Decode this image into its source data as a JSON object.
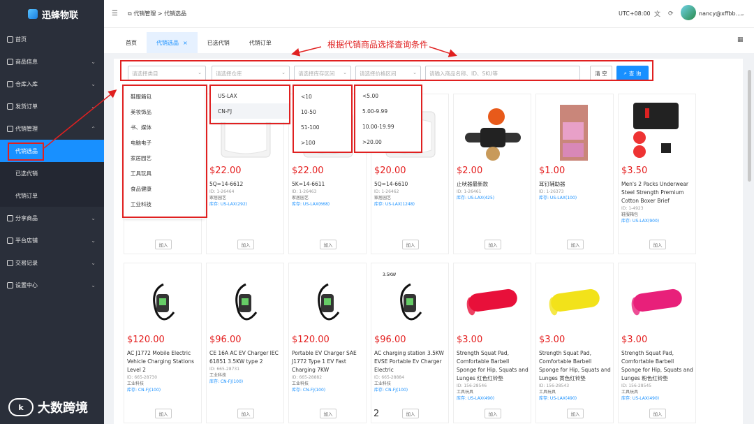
{
  "app": {
    "name": "迅蜂物联"
  },
  "sidebar": {
    "items": [
      {
        "label": "首页"
      },
      {
        "label": "商品信息"
      },
      {
        "label": "仓库入库"
      },
      {
        "label": "发货订单"
      },
      {
        "label": "代销管理"
      },
      {
        "label": "代销选品"
      },
      {
        "label": "已选代销"
      },
      {
        "label": "代销订单"
      },
      {
        "label": "分享商品"
      },
      {
        "label": "平台店铺"
      },
      {
        "label": "交易记录"
      },
      {
        "label": "设置中心"
      }
    ]
  },
  "topbar": {
    "breadcrumb_parent": "代销管理",
    "breadcrumb_sep": ">",
    "breadcrumb_current": "代销选品",
    "timezone": "UTC+08:00",
    "user": "nancy@xffbb...."
  },
  "tabs": [
    {
      "label": "首页"
    },
    {
      "label": "代销选品"
    },
    {
      "label": "已选代销"
    },
    {
      "label": "代销订单"
    }
  ],
  "annotation": "根据代销商品选择查询条件",
  "filters": {
    "category_placeholder": "请选择类目",
    "warehouse_placeholder": "请选择仓库",
    "stock_placeholder": "请选择库存区间",
    "price_placeholder": "请选择价格区间",
    "search_placeholder": "请输入商品名称、ID、SKU等",
    "clear_label": "清 空",
    "query_label": "查 询"
  },
  "dropdowns": {
    "categories": [
      "鞋服箱包",
      "美妆饰品",
      "书、媒体",
      "电脑电子",
      "家居园艺",
      "工具玩具",
      "食品健康",
      "工业科技"
    ],
    "warehouses": [
      "US-LAX",
      "CN-FJ"
    ],
    "stock_ranges": [
      "<10",
      "10-50",
      "51-100",
      ">100"
    ],
    "price_ranges": [
      "<5.00",
      "5.00-9.99",
      "10.00-19.99",
      ">20.00"
    ]
  },
  "add_label": "加入",
  "products_row1": [
    {
      "price": "",
      "title": "",
      "id": "",
      "cat": "",
      "stock": ""
    },
    {
      "price": "$22.00",
      "title": "5Q=14-6612",
      "id": "ID: 1-26464",
      "cat": "家居园艺",
      "stock": "库存: US-LAX(292)"
    },
    {
      "price": "$22.00",
      "title": "5K=14-6611",
      "id": "ID: 1-26463",
      "cat": "家居园艺",
      "stock": "库存: US-LAX(668)"
    },
    {
      "price": "$20.00",
      "title": "5Q=14-6610",
      "id": "ID: 1-26462",
      "cat": "家居园艺",
      "stock": "库存: US-LAX(1248)"
    },
    {
      "price": "$2.00",
      "title": "止吠器最新款",
      "id": "ID: 1-26461",
      "cat": "",
      "stock": "库存: US-LAX(425)"
    },
    {
      "price": "$1.00",
      "title": "耳钉辅助器",
      "id": "ID: 1-26373",
      "cat": "",
      "stock": "库存: US-LAX(100)"
    },
    {
      "price": "$3.50",
      "title": "Men's 2 Packs Underwear Steel Strength Premium Cotton Boxer Brief",
      "id": "ID: 1-4923",
      "cat": "鞋服箱包",
      "stock": "库存: US-LAX(900)"
    }
  ],
  "products_row2": [
    {
      "price": "$120.00",
      "title": "AC J1772 Mobile Electric Vehicle Charging Stations Level 2",
      "id": "ID: 665-28730",
      "cat": "工业科技",
      "stock": "库存: CN-FJ(100)"
    },
    {
      "price": "$96.00",
      "title": "CE 16A AC EV Charger IEC 61851 3.5KW type 2",
      "id": "ID: 665-28731",
      "cat": "工业科技",
      "stock": "库存: CN-FJ(100)"
    },
    {
      "price": "$120.00",
      "title": "Portable EV Charger SAE J1772 Type 1 EV Fast Charging 7KW",
      "id": "ID: 665-28882",
      "cat": "工业科技",
      "stock": "库存: CN-FJ(100)"
    },
    {
      "price": "$96.00",
      "title": "AC charging station 3.5KW EVSE Portable Ev Charger Electric",
      "id": "ID: 665-28884",
      "cat": "工业科技",
      "stock": "库存: CN-FJ(100)"
    },
    {
      "price": "$3.00",
      "title": "Strength Squat Pad, Comfortable Barbell Sponge for Hip, Squats and Lunges 红色红铃垫",
      "id": "ID: 156-28546",
      "cat": "工具玩具",
      "stock": "库存: US-LAX(490)"
    },
    {
      "price": "$3.00",
      "title": "Strength Squat Pad, Comfortable Barbell Sponge for Hip, Squats and Lunges 黄色红铃垫",
      "id": "ID: 156-28543",
      "cat": "工具玩具",
      "stock": "库存: US-LAX(490)"
    },
    {
      "price": "$3.00",
      "title": "Strength Squat Pad, Comfortable Barbell Sponge for Hip, Squats and Lunges 粉色红铃垫",
      "id": "ID: 156-28545",
      "cat": "工具玩具",
      "stock": "库存: US-LAX(490)"
    }
  ],
  "charger_labels": {
    "c1": "3.5KW",
    "c2": "CE(Rohs)"
  },
  "page_number": "2",
  "watermark": {
    "logo": "k",
    "text": "大数跨境"
  },
  "colors": {
    "accent": "#1890ff",
    "price": "#e41e1e",
    "annotation": "#e02020"
  }
}
